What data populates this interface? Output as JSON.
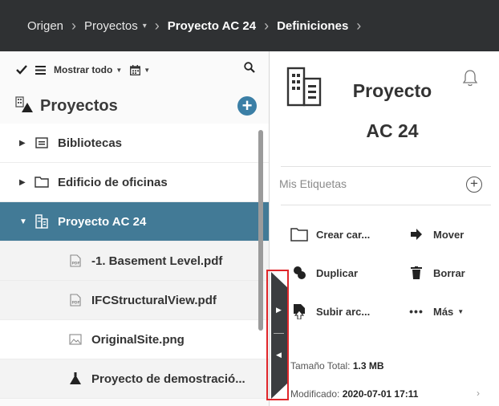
{
  "breadcrumb": {
    "items": [
      "Origen",
      "Proyectos",
      "Proyecto AC 24",
      "Definiciones"
    ],
    "separator": ">",
    "proyectos_caret": "▾"
  },
  "toolbar": {
    "show_all_label": "Mostrar todo"
  },
  "left_panel": {
    "title": "Proyectos",
    "add_label": "+",
    "tree": [
      {
        "label": "Bibliotecas"
      },
      {
        "label": "Edificio de oficinas"
      },
      {
        "label": "Proyecto AC 24"
      },
      {
        "label": "-1. Basement Level.pdf"
      },
      {
        "label": "IFCStructuralView.pdf"
      },
      {
        "label": "OriginalSite.png"
      },
      {
        "label": "Proyecto de demostració..."
      }
    ]
  },
  "right_panel": {
    "title": "Proyecto AC 24",
    "tags_label": "Mis Etiquetas",
    "actions": {
      "create_folder": "Crear car...",
      "move": "Mover",
      "duplicate": "Duplicar",
      "delete": "Borrar",
      "upload": "Subir arc...",
      "more": "Más"
    },
    "meta": {
      "size_label": "Tamaño Total:",
      "size_value": "1.3 MB",
      "modified_label": "Modificado:",
      "modified_value": "2020-07-01 17:11"
    }
  },
  "colors": {
    "header_bg": "#2f3133",
    "selected_row": "#427a96",
    "accent": "#3b7fa6",
    "highlight_frame": "#e0262a"
  }
}
